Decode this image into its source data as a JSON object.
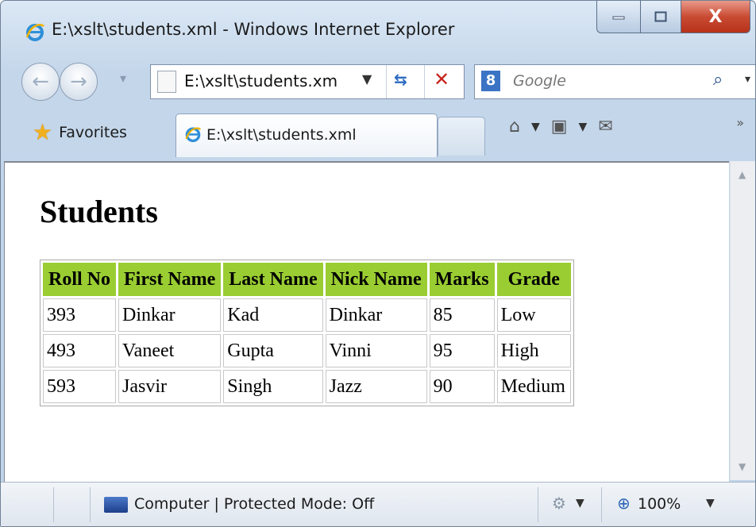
{
  "window": {
    "title": "E:\\xslt\\students.xml - Windows Internet Explorer",
    "caption_buttons": {
      "minimize": "minimize-icon",
      "maximize": "maximize-icon",
      "close": "X"
    }
  },
  "nav": {
    "address": "E:\\xslt\\students.xm",
    "search_engine": "8",
    "search_placeholder": "Google"
  },
  "favorites_bar": {
    "favorites_label": "Favorites",
    "tab_label": "E:\\xslt\\students.xml"
  },
  "page": {
    "heading": "Students",
    "table": {
      "headers": [
        "Roll No",
        "First Name",
        "Last Name",
        "Nick Name",
        "Marks",
        "Grade"
      ],
      "rows": [
        [
          "393",
          "Dinkar",
          "Kad",
          "Dinkar",
          "85",
          "Low"
        ],
        [
          "493",
          "Vaneet",
          "Gupta",
          "Vinni",
          "95",
          "High"
        ],
        [
          "593",
          "Jasvir",
          "Singh",
          "Jazz",
          "90",
          "Medium"
        ]
      ]
    }
  },
  "status_bar": {
    "zone": "Computer | Protected Mode: Off",
    "zoom": "100%"
  },
  "colors": {
    "header_bg": "#9acd32",
    "chrome_bg": "#c4d6ea",
    "close_button": "#c94b33"
  }
}
